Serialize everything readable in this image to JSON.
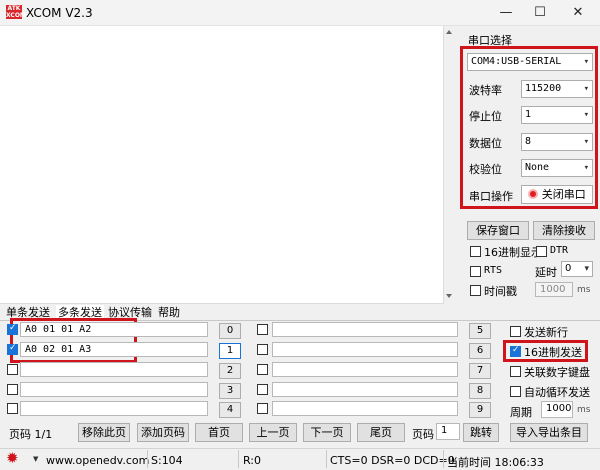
{
  "window": {
    "title": "XCOM V2.3",
    "logo_text": "ATK\nXCOM",
    "minimize": "—",
    "maximize": "☐",
    "close": "✕"
  },
  "port_panel": {
    "section_title": "串口选择",
    "port": "COM4:USB-SERIAL",
    "baud_label": "波特率",
    "baud": "115200",
    "stop_label": "停止位",
    "stop": "1",
    "data_label": "数据位",
    "data": "8",
    "parity_label": "校验位",
    "parity": "None",
    "op_label": "串口操作",
    "op_button": "关闭串口"
  },
  "actions": {
    "save_window": "保存窗口",
    "clear_recv": "清除接收",
    "hex_display": "16进制显示",
    "dtr": "DTR",
    "rts": "RTS",
    "delay_label": "延时",
    "delay_value": "0",
    "timestamp": "时间戳",
    "timestamp_value": "1000",
    "ms": "ms"
  },
  "tabs": [
    "单条发送",
    "多条发送",
    "协议传输",
    "帮助"
  ],
  "rows_left": [
    {
      "checked": true,
      "text": "A0 01 01 A2",
      "num": "0"
    },
    {
      "checked": true,
      "text": "A0 02 01 A3",
      "num": "1"
    },
    {
      "checked": false,
      "text": "",
      "num": "2"
    },
    {
      "checked": false,
      "text": "",
      "num": "3"
    },
    {
      "checked": false,
      "text": "",
      "num": "4"
    }
  ],
  "rows_right": [
    {
      "checked": false,
      "text": "",
      "num": "5"
    },
    {
      "checked": false,
      "text": "",
      "num": "6"
    },
    {
      "checked": false,
      "text": "",
      "num": "7"
    },
    {
      "checked": false,
      "text": "",
      "num": "8"
    },
    {
      "checked": false,
      "text": "",
      "num": "9"
    }
  ],
  "options": {
    "send_newline": "发送新行",
    "hex_send": "16进制发送",
    "link_keyboard": "关联数字键盘",
    "auto_cycle": "自动循环发送",
    "period_label": "周期",
    "period_value": "1000",
    "ms": "ms"
  },
  "page_bar": {
    "page_label": "页码 1/1",
    "remove_page": "移除此页",
    "add_page": "添加页码",
    "first": "首页",
    "prev": "上一页",
    "next": "下一页",
    "last": "尾页",
    "page_input_label": "页码",
    "page_input_value": "1",
    "jump": "跳转",
    "import_export": "导入导出条目"
  },
  "status": {
    "website": "www.openedv.com",
    "sent": "S:104",
    "recv": "R:0",
    "signals": "CTS=0 DSR=0 DCD=0",
    "time": "当前时间 18:06:33"
  }
}
